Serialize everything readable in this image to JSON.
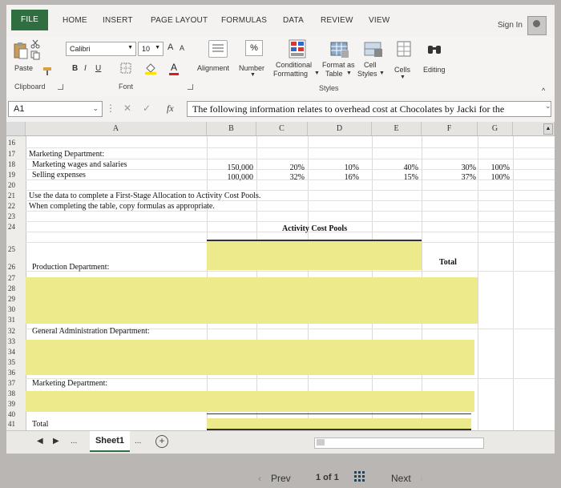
{
  "ribbon_tabs": [
    "FILE",
    "HOME",
    "INSERT",
    "PAGE LAYOUT",
    "FORMULAS",
    "DATA",
    "REVIEW",
    "VIEW"
  ],
  "sign_in": "Sign In",
  "clipboard": {
    "paste": "Paste",
    "label": "Clipboard"
  },
  "font": {
    "name": "Calibri",
    "size": "10",
    "bold": "B",
    "italic": "I",
    "underline": "U",
    "grow": "A",
    "shrink": "A",
    "color_letter": "A",
    "label": "Font"
  },
  "alignment": {
    "label": "Alignment"
  },
  "number": {
    "symbol": "%",
    "label": "Number"
  },
  "styles": {
    "conditional": "Conditional",
    "formatting": "Formatting",
    "format_as": "Format as",
    "table": "Table",
    "cell": "Cell",
    "styles": "Styles",
    "label": "Styles"
  },
  "cells": {
    "label": "Cells"
  },
  "editing": {
    "label": "Editing"
  },
  "formula_bar": {
    "name_box": "A1",
    "fx": "fx",
    "content": "The following information relates to overhead cost at Chocolates by Jacki for the"
  },
  "columns": [
    "A",
    "B",
    "C",
    "D",
    "E",
    "F",
    "G"
  ],
  "rows": {
    "r16": "16",
    "r17": {
      "num": "17",
      "a": "Marketing Department:"
    },
    "r18": {
      "num": "18",
      "a": "Marketing wages and salaries",
      "b": "150,000",
      "c": "20%",
      "d": "10%",
      "e": "40%",
      "f": "30%",
      "g": "100%"
    },
    "r19": {
      "num": "19",
      "a": "Selling expenses",
      "b": "100,000",
      "c": "32%",
      "d": "16%",
      "e": "15%",
      "f": "37%",
      "g": "100%"
    },
    "r20": "20",
    "r21": {
      "num": "21",
      "a": "Use the data to complete a First-Stage Allocation to Activity Cost Pools."
    },
    "r22": {
      "num": "22",
      "a": "When completing the table, copy formulas as appropriate."
    },
    "r23": "23",
    "r24": {
      "num": "24",
      "c": "Activity Cost Pools"
    },
    "r25": {
      "num": "25",
      "f": "Total"
    },
    "r26": {
      "num": "26",
      "a": "Production Department:"
    },
    "r27": "27",
    "r28": "28",
    "r29": "29",
    "r30": "30",
    "r31": "31",
    "r32": {
      "num": "32",
      "a": "General Administration Department:"
    },
    "r33": "33",
    "r34": "34",
    "r35": "35",
    "r36": "36",
    "r37": {
      "num": "37",
      "a": "Marketing Department:"
    },
    "r38": "38",
    "r39": "39",
    "r40": "40",
    "r41": {
      "num": "41",
      "a": "Total"
    }
  },
  "sheet_tab": "Sheet1",
  "sheet_ellipsis": "...",
  "viewer": {
    "prev": "Prev",
    "page": "1 of 1",
    "next": "Next"
  },
  "colors": {
    "file_tab": "#2f6f3f",
    "highlight": "#ecea8a"
  }
}
